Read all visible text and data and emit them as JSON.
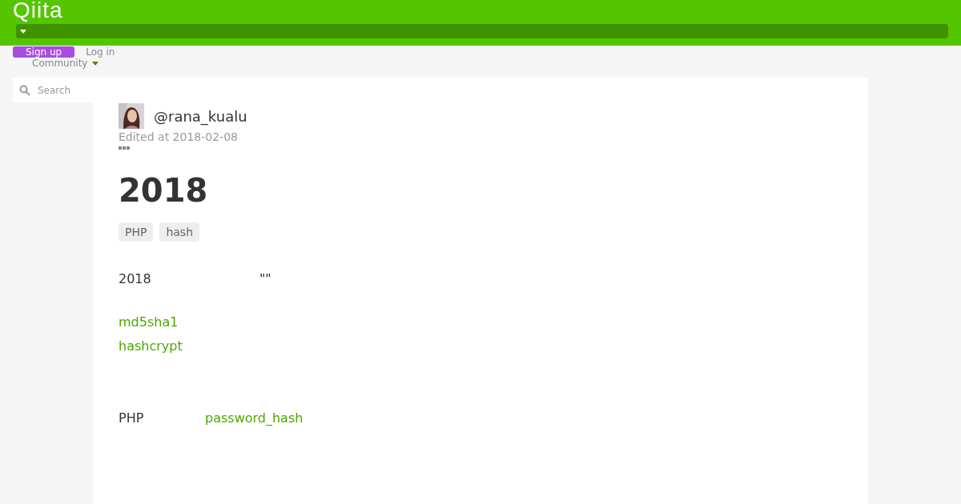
{
  "header": {
    "logo": "Qiita"
  },
  "nav": {
    "sign_up": "Sign up",
    "log_in": "Log in",
    "community": "Community"
  },
  "search": {
    "placeholder": "Search"
  },
  "article": {
    "author": "@rana_kualu",
    "edited": "Edited at 2018-02-08",
    "title": "2018",
    "tags": [
      "PHP",
      "hash"
    ],
    "blocks": [
      {
        "kind": "text",
        "parts": [
          "2018",
          "\"\""
        ]
      },
      {
        "kind": "link",
        "parts": [
          "md5sha1"
        ]
      },
      {
        "kind": "link",
        "parts": [
          "hashcrypt"
        ]
      },
      {
        "kind": "mixed",
        "parts": [
          "PHP",
          "password_hash"
        ]
      }
    ]
  }
}
